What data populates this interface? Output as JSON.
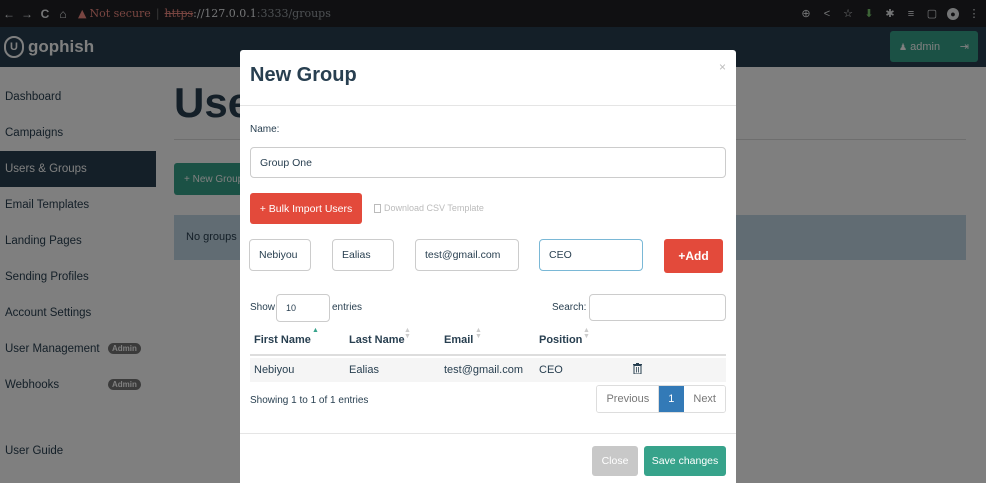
{
  "browser": {
    "back": "←",
    "forward": "→",
    "reload": "C",
    "home": "⌂",
    "warning_icon": "▲",
    "not_secure": "Not secure",
    "separator": "|",
    "url_scheme": "https",
    "url_host": "://127.0.0.1",
    "url_path": ":3333/groups",
    "icons": [
      "zoom-icon",
      "share-icon",
      "star-icon",
      "extension-icon",
      "puzzle-icon",
      "reading-list-icon",
      "sidebar-icon",
      "profile-icon",
      "menu-icon"
    ]
  },
  "navbar": {
    "logo_text": "gophish",
    "user_label": "admin",
    "user_icon": "👤",
    "logout_icon": "⇥"
  },
  "sidebar": {
    "items": [
      {
        "label": "Dashboard",
        "active": false
      },
      {
        "label": "Campaigns",
        "active": false
      },
      {
        "label": "Users & Groups",
        "active": true
      },
      {
        "label": "Email Templates",
        "active": false
      },
      {
        "label": "Landing Pages",
        "active": false
      },
      {
        "label": "Sending Profiles",
        "active": false
      },
      {
        "label": "Account Settings",
        "active": false
      },
      {
        "label": "User Management",
        "active": false,
        "badge": "Admin"
      },
      {
        "label": "Webhooks",
        "active": false,
        "badge": "Admin"
      }
    ],
    "user_guide": "User Guide"
  },
  "page": {
    "title": "Users & Groups",
    "new_group_button": "+ New Group",
    "empty_message": "No groups created yet. Let's create one!"
  },
  "modal": {
    "title": "New Group",
    "close_x": "×",
    "name_label": "Name:",
    "name_value": "Group One",
    "bulk_import": "+ Bulk Import Users",
    "download_csv": "Download CSV Template",
    "first_name_value": "Nebiyou",
    "last_name_value": "Ealias",
    "email_value": "test@gmail.com",
    "position_value": "CEO",
    "add_button": "+Add",
    "show_label": "Show",
    "show_value": "10",
    "entries_label": "entries",
    "search_label": "Search:",
    "columns": [
      "First Name",
      "Last Name",
      "Email",
      "Position"
    ],
    "rows": [
      {
        "first_name": "Nebiyou",
        "last_name": "Ealias",
        "email": "test@gmail.com",
        "position": "CEO"
      }
    ],
    "showing_text": "Showing 1 to 1 of 1 entries",
    "pagination": {
      "previous": "Previous",
      "current": "1",
      "next": "Next"
    },
    "close_button": "Close",
    "save_button": "Save changes"
  },
  "colors": {
    "navbar": "#283f50",
    "accent_green": "#37a38b",
    "danger_red": "#e34a3b",
    "primary_blue": "#337ab7"
  }
}
